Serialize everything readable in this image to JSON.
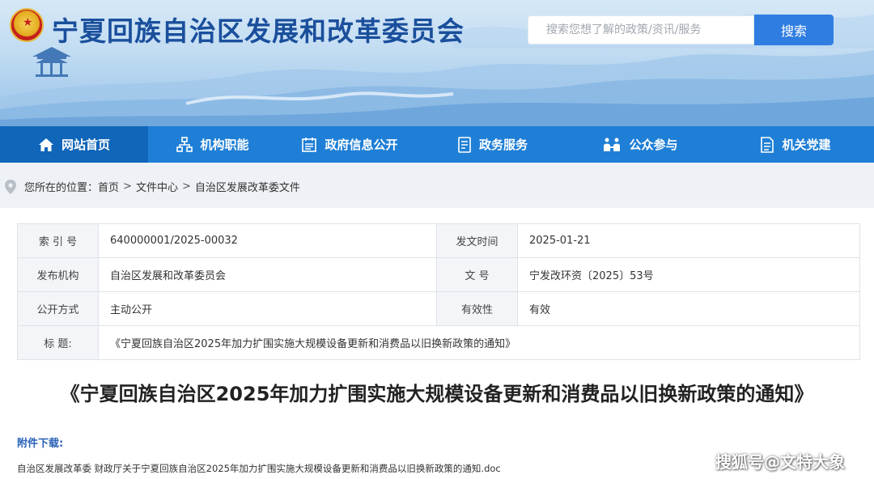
{
  "header": {
    "site_title": "宁夏回族自治区发展和改革委员会",
    "search_placeholder": "搜索您想了解的政策/资讯/服务",
    "search_button": "搜索"
  },
  "nav": [
    {
      "label": "网站首页",
      "icon": "home-icon"
    },
    {
      "label": "机构职能",
      "icon": "org-chart-icon"
    },
    {
      "label": "政府信息公开",
      "icon": "calendar-list-icon"
    },
    {
      "label": "政务服务",
      "icon": "document-list-icon"
    },
    {
      "label": "公众参与",
      "icon": "people-icon"
    },
    {
      "label": "机关党建",
      "icon": "document-icon"
    }
  ],
  "breadcrumb": {
    "prefix": "您所在的位置：",
    "items": [
      "首页",
      "文件中心",
      "自治区发展改革委文件"
    ],
    "separator": ">"
  },
  "meta": {
    "index_no_label": "索 引 号",
    "index_no": "640000001/2025-00032",
    "date_label": "发文时间",
    "date": "2025-01-21",
    "publisher_label": "发布机构",
    "publisher": "自治区发展和改革委员会",
    "doc_no_label": "文 号",
    "doc_no": "宁发改环资〔2025〕53号",
    "open_mode_label": "公开方式",
    "open_mode": "主动公开",
    "validity_label": "有效性",
    "validity": "有效",
    "title_label": "标 题:",
    "title": "《宁夏回族自治区2025年加力扩围实施大规模设备更新和消费品以旧换新政策的通知》"
  },
  "document": {
    "heading": "《宁夏回族自治区2025年加力扩围实施大规模设备更新和消费品以旧换新政策的通知》",
    "attachment_label": "附件下载:",
    "attachment_file": "自治区发展改革委 财政厅关于宁夏回族自治区2025年加力扩围实施大规模设备更新和消费品以旧换新政策的通知.doc"
  },
  "watermark": "搜狐号@文特大象",
  "colors": {
    "nav_bg": "#1f7fd6",
    "nav_active": "#1066b9",
    "title_blue": "#1a4f9c",
    "search_button": "#2f7de1",
    "attachment_label": "#2a62b8"
  }
}
